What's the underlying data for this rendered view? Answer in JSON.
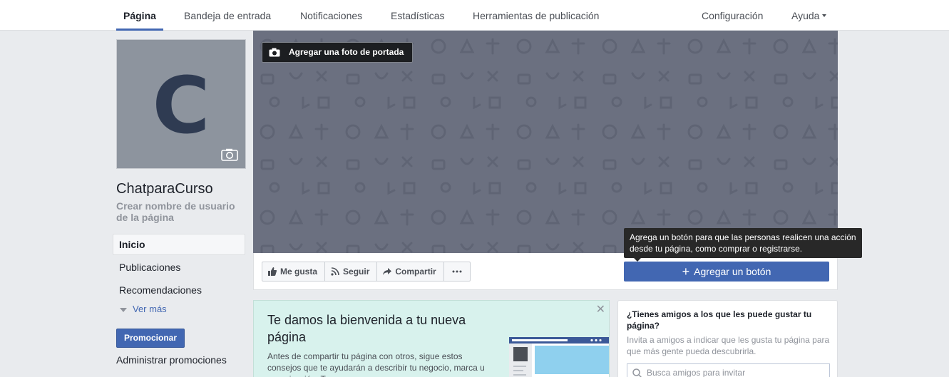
{
  "topbar": {
    "tabs": [
      {
        "label": "Página",
        "active": true
      },
      {
        "label": "Bandeja de entrada"
      },
      {
        "label": "Notificaciones"
      },
      {
        "label": "Estadísticas"
      },
      {
        "label": "Herramientas de publicación"
      }
    ],
    "settings_label": "Configuración",
    "help_label": "Ayuda"
  },
  "profile": {
    "initial": "C",
    "name": "ChatparaCurso",
    "username_link": "Crear nombre de usuario de la página",
    "camera_icon": "camera-icon"
  },
  "sidebar": {
    "items": [
      {
        "label": "Inicio",
        "active": true
      },
      {
        "label": "Publicaciones"
      },
      {
        "label": "Recomendaciones"
      }
    ],
    "more_label": "Ver más",
    "promote_label": "Promocionar",
    "manage_promos_label": "Administrar promociones"
  },
  "cover": {
    "add_cover_label": "Agregar una foto de portada"
  },
  "actions": {
    "like_label": "Me gusta",
    "follow_label": "Seguir",
    "share_label": "Compartir",
    "more_icon": "ellipsis-icon",
    "add_button_label": "Agregar un botón",
    "tooltip": "Agrega un botón para que las personas realicen una acción desde tu página, como comprar o registrarse."
  },
  "welcome": {
    "title": "Te damos la bienvenida a tu nueva página",
    "description": "Antes de compartir tu página con otros, sigue estos consejos que te ayudarán a describir tu negocio, marca u organización. Te"
  },
  "invite": {
    "title": "¿Tienes amigos a los que les puede gustar tu página?",
    "description": "Invita a amigos a indicar que les gusta tu página para que más gente pueda descubrirla.",
    "search_placeholder": "Busca amigos para invitar"
  },
  "colors": {
    "brand_blue": "#4267b2",
    "cover_gray": "#6b7080",
    "welcome_bg": "#d8f2ed",
    "page_bg": "#e9ebee"
  }
}
